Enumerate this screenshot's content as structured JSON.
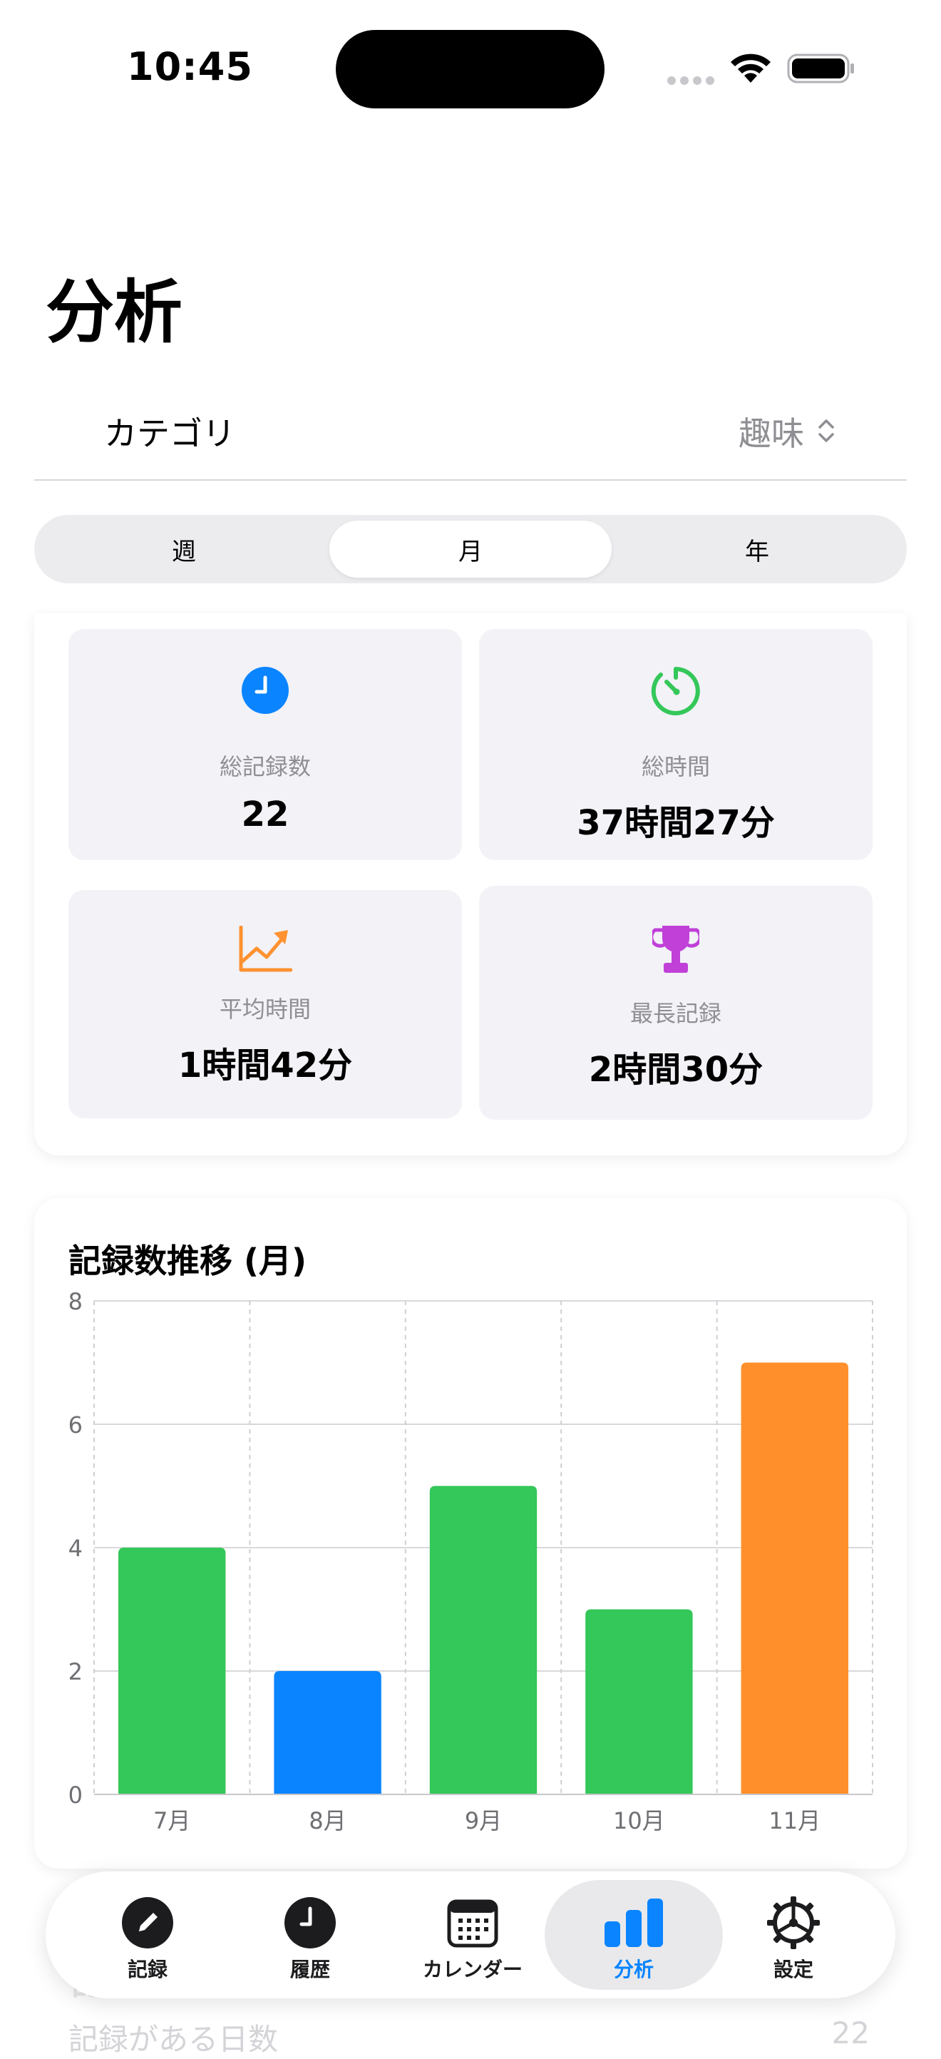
{
  "status_bar": {
    "time": "10:45"
  },
  "page": {
    "title": "分析"
  },
  "category": {
    "label": "カテゴリ",
    "value": "趣味"
  },
  "period_segment": {
    "options": [
      "週",
      "月",
      "年"
    ],
    "selected": "月"
  },
  "stats": [
    {
      "icon": "clock-icon",
      "label": "総記録数",
      "value": "22",
      "color": "#0a84ff"
    },
    {
      "icon": "timer-icon",
      "label": "総時間",
      "value": "37時間27分",
      "color": "#34c759"
    },
    {
      "icon": "trend-chart-icon",
      "label": "平均時間",
      "value": "1時間42分",
      "color": "#ff9230"
    },
    {
      "icon": "trophy-icon",
      "label": "最長記録",
      "value": "2時間30分",
      "color": "#c040d8"
    }
  ],
  "chart_data": {
    "type": "bar",
    "title": "記録数推移 (月)",
    "categories": [
      "7月",
      "8月",
      "9月",
      "10月",
      "11月"
    ],
    "values": [
      4,
      2,
      5,
      3,
      7
    ],
    "bar_colors": [
      "#34c759",
      "#0a84ff",
      "#34c759",
      "#34c759",
      "#ff8f2b"
    ],
    "ylim": [
      0,
      8
    ],
    "yticks": [
      0,
      2,
      4,
      6,
      8
    ],
    "grid": true
  },
  "tabbar": {
    "items": [
      {
        "label": "記録",
        "icon": "pencil-icon"
      },
      {
        "label": "履歴",
        "icon": "clock-icon"
      },
      {
        "label": "カレンダー",
        "icon": "calendar-icon"
      },
      {
        "label": "分析",
        "icon": "bar-chart-icon"
      },
      {
        "label": "設定",
        "icon": "gear-icon"
      }
    ],
    "selected": "分析",
    "accent": "#0a84ff"
  },
  "below_fold": {
    "heading": "記録統計",
    "row_label": "記録がある日数",
    "row_value": "22"
  }
}
